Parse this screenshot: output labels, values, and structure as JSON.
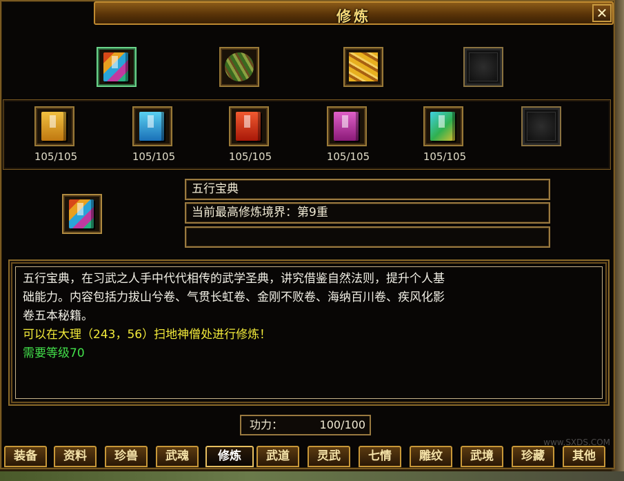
{
  "window": {
    "title": "修炼",
    "help_label": "?",
    "close_label": "✕"
  },
  "top_slots": [
    {
      "item": "wuxing-book-icon",
      "state": "selected"
    },
    {
      "item": "bamboo-scroll-icon",
      "state": "filled"
    },
    {
      "item": "golden-scroll-icon",
      "state": "filled"
    },
    {
      "item": "empty-slot-icon",
      "state": "empty"
    }
  ],
  "sub_slots": [
    {
      "item": "yellow-book-icon",
      "color": "#e8a020",
      "count": "105/105"
    },
    {
      "item": "blue-book-icon",
      "color": "#2aa4d8",
      "count": "105/105"
    },
    {
      "item": "red-book-icon",
      "color": "#d83018",
      "count": "105/105"
    },
    {
      "item": "purple-book-icon",
      "color": "#c03aa0",
      "count": "105/105"
    },
    {
      "item": "green-book-icon",
      "color": "#2ab080",
      "count": "105/105"
    },
    {
      "item": "empty-slot-icon",
      "color": "#202020",
      "count": ""
    }
  ],
  "detail": {
    "name": "五行宝典",
    "realm": "当前最高修炼境界：第9重",
    "extra": ""
  },
  "description": {
    "line1": "五行宝典，在习武之人手中代代相传的武学圣典，讲究借鉴自然法则，提升个人基",
    "line2": "础能力。内容包括力拔山兮卷、气贯长虹卷、金刚不败卷、海纳百川卷、疾风化影",
    "line3": "卷五本秘籍。",
    "location": "可以在大理（243，56）扫地神僧处进行修炼！",
    "requirement": "需要等级70"
  },
  "power": {
    "label": "功力：",
    "value": "100/100"
  },
  "tabs": [
    {
      "label": "装备"
    },
    {
      "label": "资料"
    },
    {
      "label": "珍兽"
    },
    {
      "label": "武魂"
    },
    {
      "label": "修炼"
    },
    {
      "label": "武道"
    },
    {
      "label": "灵武"
    },
    {
      "label": "七情"
    },
    {
      "label": "雕纹"
    },
    {
      "label": "武境"
    },
    {
      "label": "珍藏"
    },
    {
      "label": "其他"
    }
  ],
  "active_tab": "修炼",
  "watermark": "www.SXDS.COM"
}
